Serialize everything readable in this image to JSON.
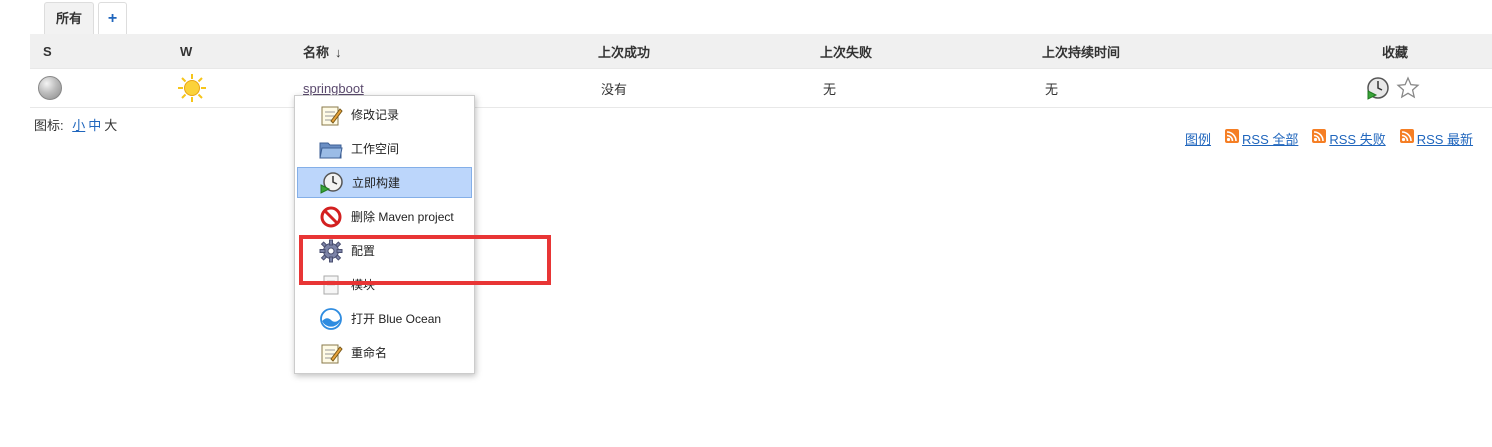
{
  "tabs": {
    "all": "所有",
    "add": "+"
  },
  "table": {
    "headers": {
      "s": "S",
      "w": "W",
      "name": "名称",
      "sort": "↓",
      "last_success": "上次成功",
      "last_failure": "上次失败",
      "last_duration": "上次持续时间",
      "favorite": "收藏"
    },
    "row": {
      "name": "springboot",
      "last_success": "没有",
      "last_failure": "无",
      "last_duration": "无",
      "status_icon": "grey-ball-icon",
      "weather_icon": "sunny-icon"
    }
  },
  "icon_size": {
    "label": "图标:",
    "small": "小",
    "medium": "中",
    "large": "大"
  },
  "rss": {
    "legend": "图例",
    "all": "RSS 全部",
    "failed": "RSS 失败",
    "latest": "RSS 最新"
  },
  "context_menu": {
    "items": [
      {
        "label": "修改记录",
        "icon": "notepad-icon"
      },
      {
        "label": "工作空间",
        "icon": "folder-icon"
      },
      {
        "label": "立即构建",
        "icon": "clock-build-icon"
      },
      {
        "label": "删除 Maven project",
        "icon": "no-entry-icon"
      },
      {
        "label": "配置",
        "icon": "gear-icon"
      },
      {
        "label": "模块",
        "icon": "document-icon"
      },
      {
        "label": "打开 Blue Ocean",
        "icon": "blue-ocean-icon"
      },
      {
        "label": "重命名",
        "icon": "notepad-icon"
      }
    ]
  },
  "colors": {
    "link": "#2066bd",
    "highlight_bg": "#bcd6fb",
    "annotation": "#e83535",
    "rss": "#f57e24"
  }
}
